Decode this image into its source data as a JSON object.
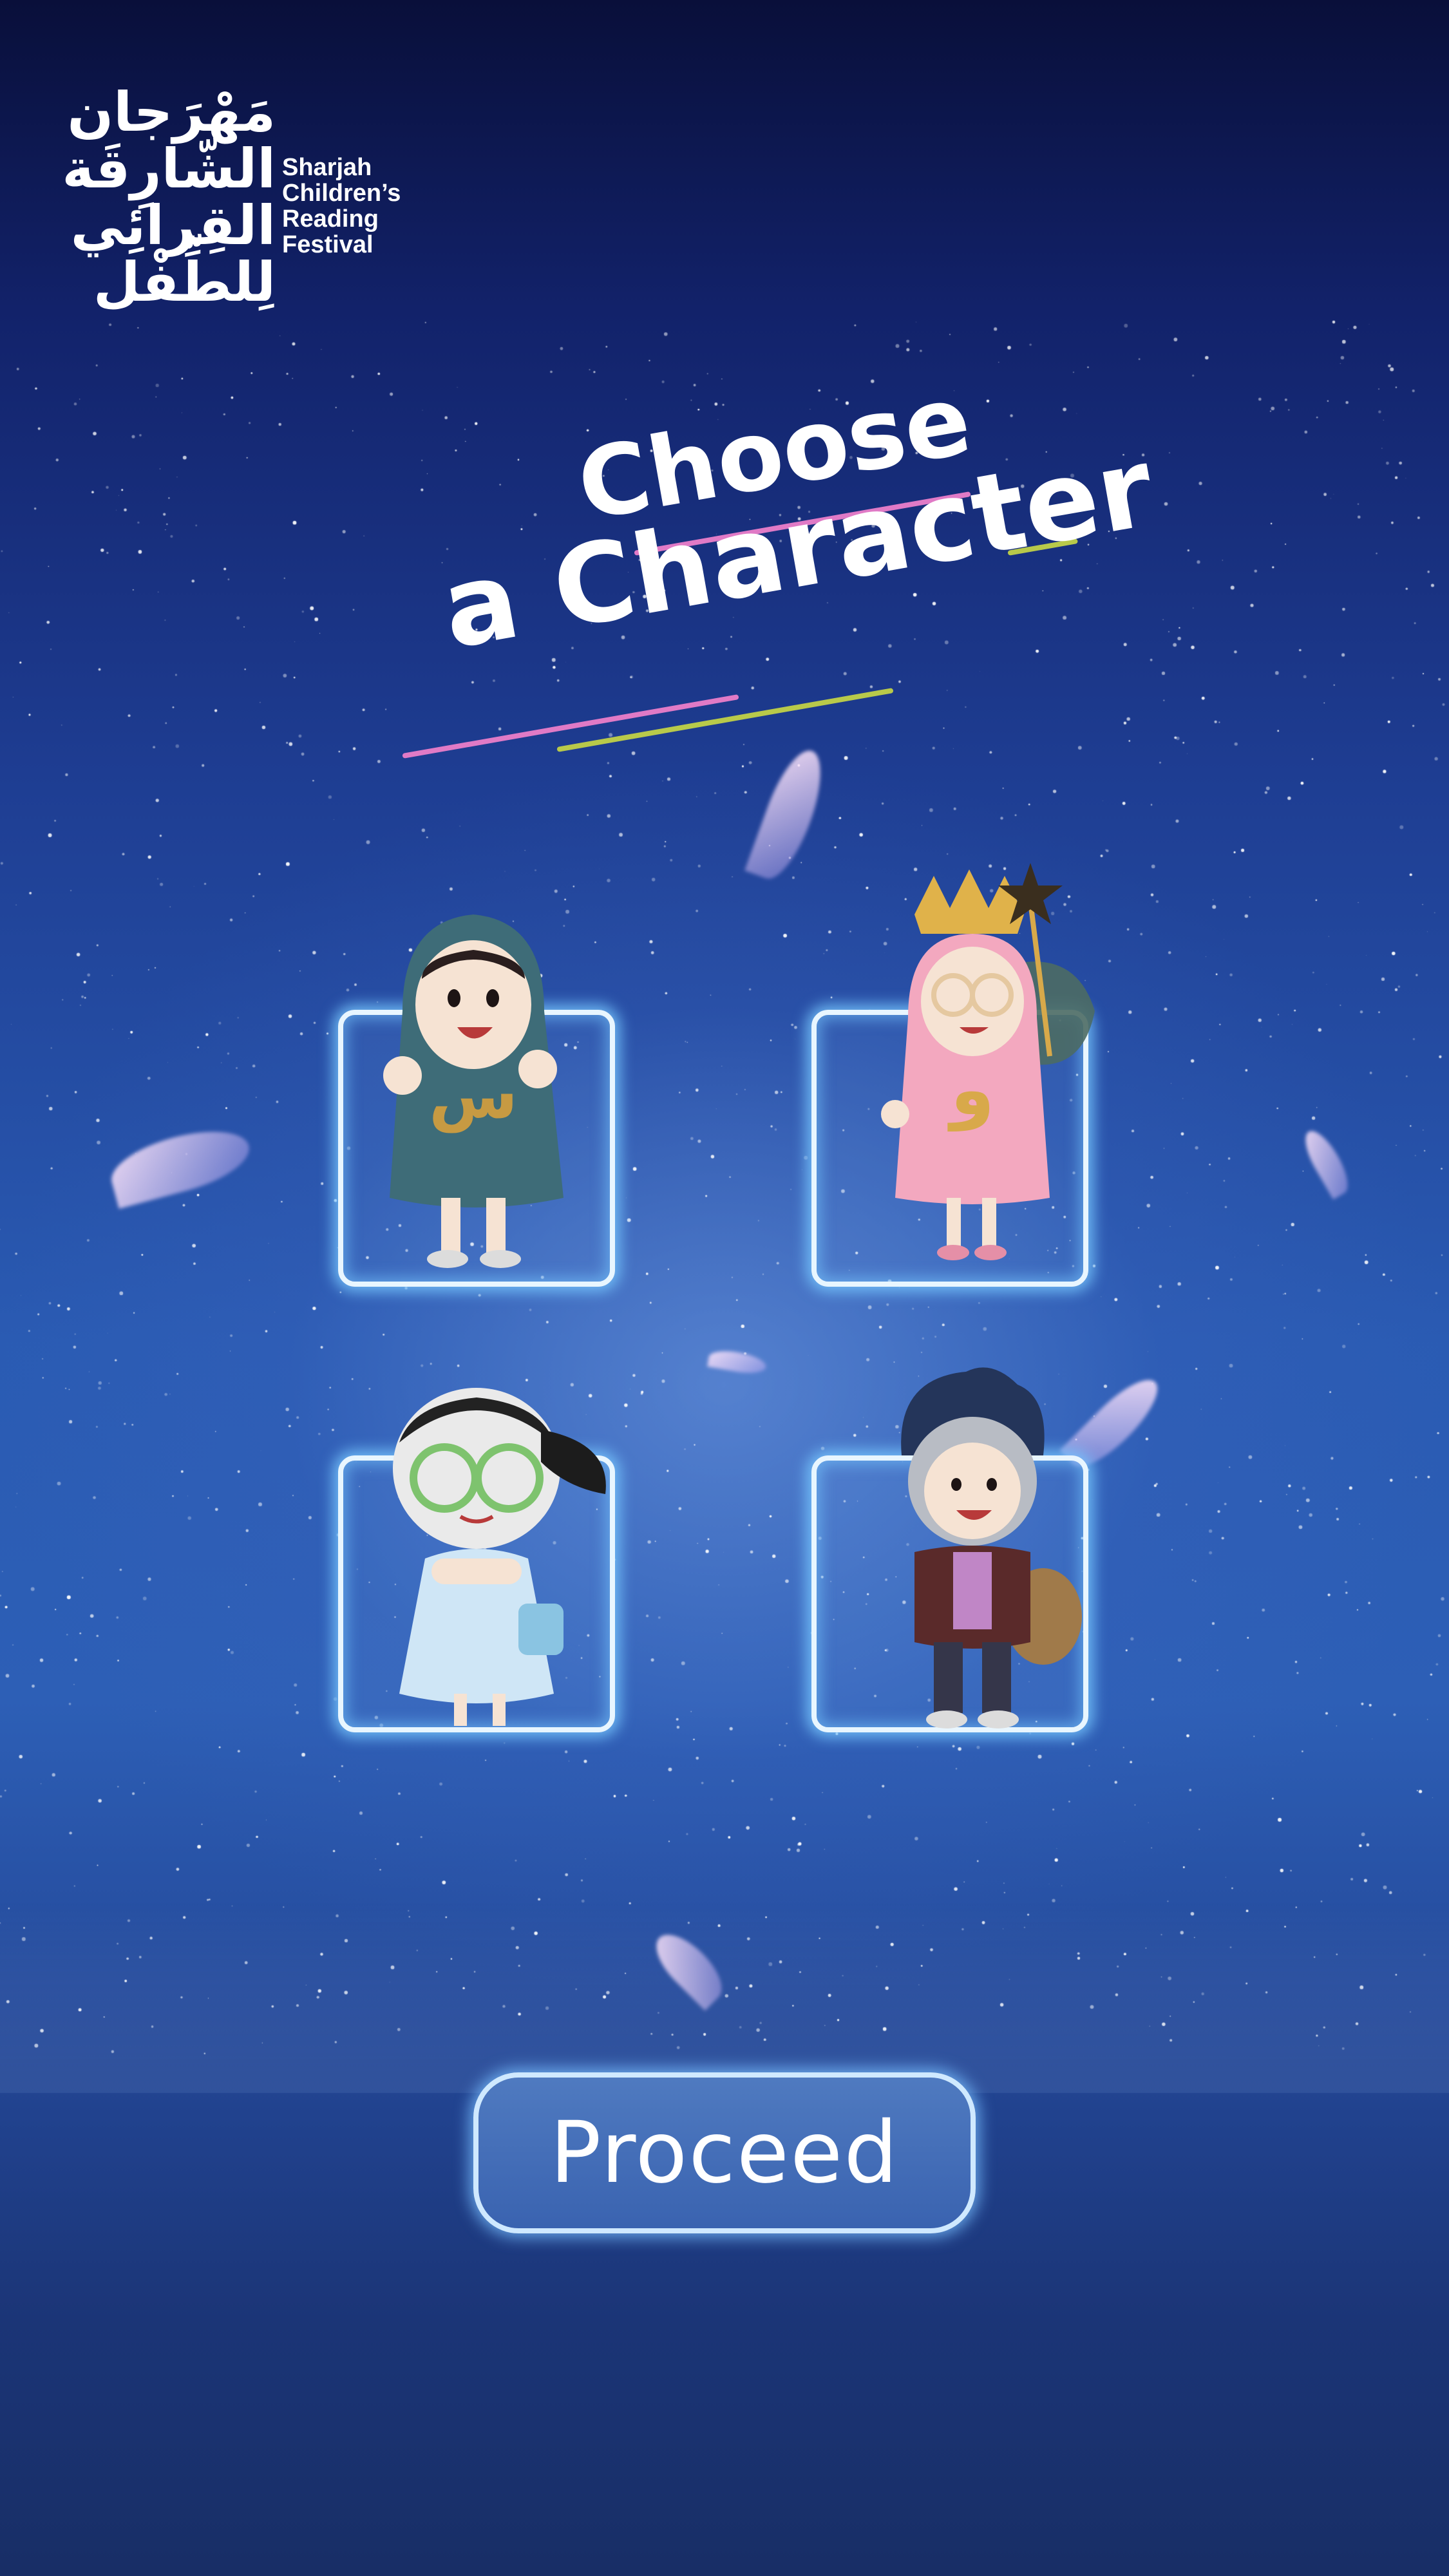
{
  "logo": {
    "arabic_lines": [
      "مَهْرَجان",
      "الشّارِقَة",
      "القِرائِي",
      "لِلطِّفْل"
    ],
    "english_lines": [
      "Sharjah",
      "Children’s",
      "Reading",
      "Festival"
    ]
  },
  "title": {
    "line1": "Choose",
    "line2": "a Character"
  },
  "characters": [
    {
      "name": "character-hooded-blue",
      "glyph": "س"
    },
    {
      "name": "character-fairy-pink",
      "glyph": "و"
    },
    {
      "name": "character-glasses-girl",
      "glyph": ""
    },
    {
      "name": "character-spiky-hair-boy",
      "glyph": ""
    }
  ],
  "proceed_button": {
    "label": "Proceed"
  },
  "colors": {
    "accent_pink": "#e07ac6",
    "accent_green": "#b8c94a",
    "card_glow": "#8fd0ff",
    "button_fill": "#4570bb"
  }
}
